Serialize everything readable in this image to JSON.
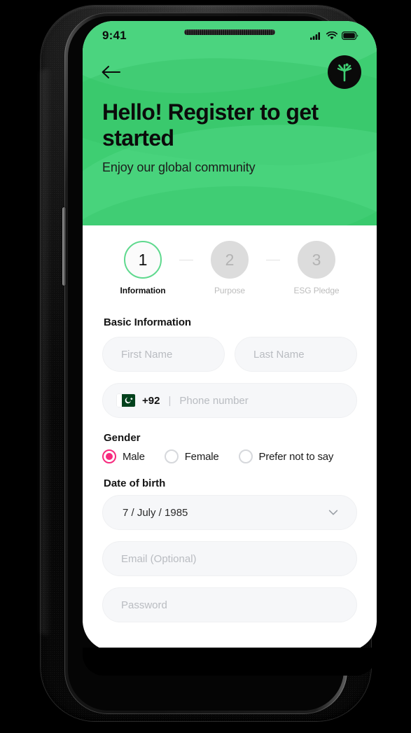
{
  "statusbar": {
    "time": "9:41",
    "icons": [
      "signal-icon",
      "wifi-icon",
      "battery-icon"
    ]
  },
  "nav": {
    "back_icon": "arrow-left-icon",
    "logo_name": "app-logo"
  },
  "header": {
    "title": "Hello! Register to get started",
    "subtitle": "Enjoy our global community",
    "bg_color": "#3ECE72"
  },
  "stepper": {
    "steps": [
      {
        "number": "1",
        "label": "Information",
        "state": "active"
      },
      {
        "number": "2",
        "label": "Purpose",
        "state": "idle"
      },
      {
        "number": "3",
        "label": "ESG Pledge",
        "state": "idle"
      }
    ],
    "active_color": "#5FD98E"
  },
  "form": {
    "section_title": "Basic Information",
    "first_name": {
      "placeholder": "First Name",
      "value": ""
    },
    "last_name": {
      "placeholder": "Last Name",
      "value": ""
    },
    "phone": {
      "country_code": "+92",
      "flag": "pakistan-flag",
      "divider": "|",
      "placeholder": "Phone number",
      "value": ""
    },
    "gender": {
      "label": "Gender",
      "options": [
        {
          "label": "Male",
          "selected": true
        },
        {
          "label": "Female",
          "selected": false
        },
        {
          "label": "Prefer not to say",
          "selected": false
        }
      ],
      "selected_color": "#F72A7E"
    },
    "dob": {
      "label": "Date of birth",
      "value": "7 / July / 1985",
      "chevron_icon": "chevron-down-icon"
    },
    "email": {
      "placeholder": "Email (Optional)",
      "value": ""
    },
    "password": {
      "placeholder": "Password",
      "value": ""
    }
  }
}
